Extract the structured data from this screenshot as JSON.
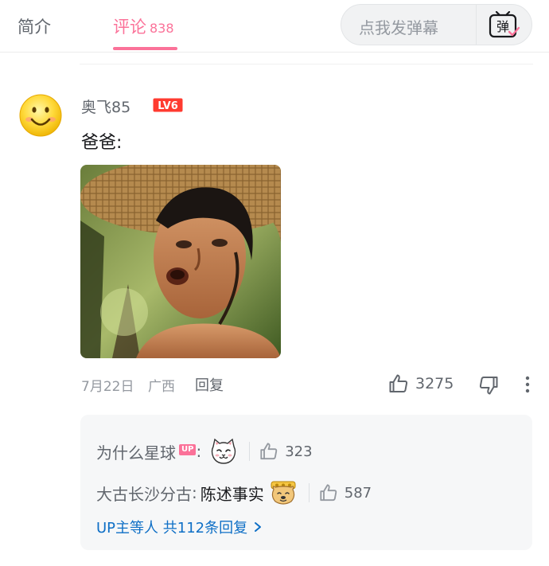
{
  "tabs": {
    "intro_label": "简介",
    "comments_label": "评论",
    "comments_count": "838"
  },
  "danmaku": {
    "placeholder": "点我发弹幕",
    "button_glyph": "弹"
  },
  "comment": {
    "username": "奥飞85",
    "level_badge": "LV6",
    "text": "爸爸:",
    "date": "7月22日",
    "location": "广西",
    "reply_label": "回复",
    "likes": "3275",
    "avatar_icon": "smiley-face-avatar",
    "image_description_icon": "meme-photo-man-straw-hat"
  },
  "replies": {
    "items": [
      {
        "user": "为什么星球",
        "badge": "UP",
        "colon": ":",
        "text": "",
        "emote_icon": "cat-face-emote",
        "likes": "323"
      },
      {
        "user": "大古长沙分古",
        "badge": "",
        "colon": ":",
        "text": "陈述事实",
        "emote_icon": "doge-emote",
        "likes": "587"
      }
    ],
    "view_more": "UP主等人 共112条回复"
  },
  "colors": {
    "accent_pink": "#fb7299",
    "link_blue": "#0e6fc6",
    "text_primary": "#18191c",
    "text_secondary": "#61666d",
    "text_muted": "#9499a0",
    "reply_bg": "#f6f7f8"
  }
}
